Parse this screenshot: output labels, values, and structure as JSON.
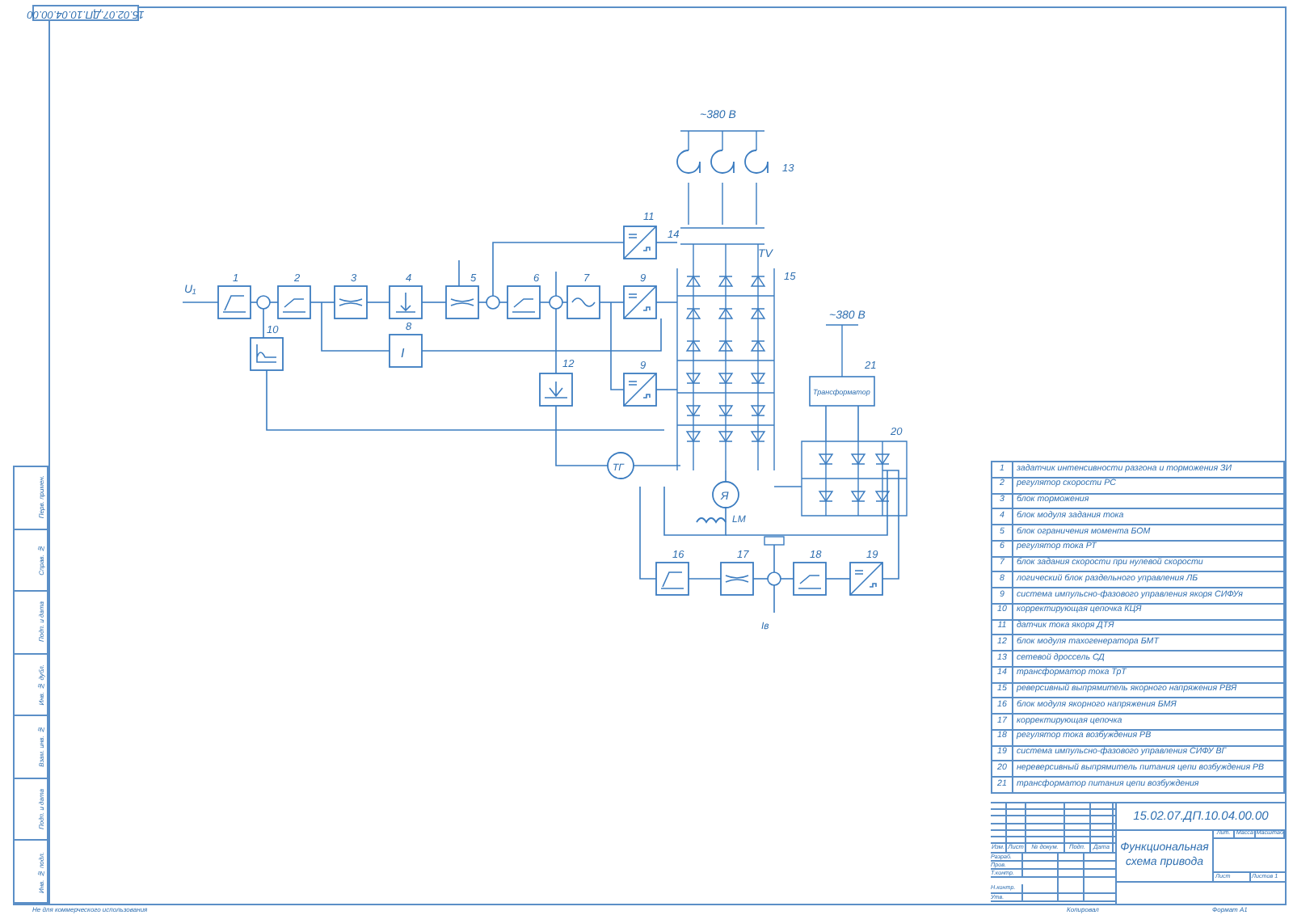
{
  "stamp": {
    "code": "15.02.07.ДП.10.04.00.00"
  },
  "side_stamp": {
    "fields": [
      "Перв. примен.",
      "Справ. №",
      "Подп. и дата",
      "Инв. № дубл.",
      "Взам. инв. №",
      "Подп. и дата",
      "Инв. № подл."
    ]
  },
  "diagram": {
    "input_label": "U₁",
    "supply_labels": [
      "~380 В",
      "~380 В"
    ],
    "transformer_label": "TV",
    "motor_label": "Я",
    "field_winding_label": "LM",
    "tacho_label": "ТГ",
    "current_label": "Iв",
    "logic_block_label": "I",
    "transformer_box_label": "Трансформатор",
    "blocks": [
      {
        "kind": "ramp"
      },
      {
        "kind": "limiter"
      },
      {
        "kind": "band"
      },
      {
        "kind": "down"
      },
      {
        "kind": "band"
      },
      {
        "kind": "limiter"
      },
      {
        "kind": "wave"
      },
      {
        "kind": "converter"
      },
      {
        "kind": "converter"
      },
      {
        "kind": "filter"
      },
      {
        "kind": "converter"
      },
      {
        "kind": "tacho"
      },
      {
        "kind": "ramp"
      },
      {
        "kind": "band"
      },
      {
        "kind": "limiter"
      },
      {
        "kind": "converter"
      }
    ],
    "markers": [
      "1",
      "2",
      "3",
      "4",
      "5",
      "6",
      "7",
      "8",
      "9",
      "9",
      "10",
      "11",
      "12",
      "13",
      "14",
      "15",
      "16",
      "17",
      "18",
      "19",
      "20",
      "21"
    ]
  },
  "legend": {
    "rows": [
      {
        "number": "1",
        "description": "задатчик интенсивности разгона и торможения ЗИ"
      },
      {
        "number": "2",
        "description": "регулятор скорости РС"
      },
      {
        "number": "3",
        "description": "блок торможения"
      },
      {
        "number": "4",
        "description": "блок модуля задания тока"
      },
      {
        "number": "5",
        "description": "блок ограничения момента БОМ"
      },
      {
        "number": "6",
        "description": "регулятор тока РТ"
      },
      {
        "number": "7",
        "description": "блок задания скорости при нулевой скорости"
      },
      {
        "number": "8",
        "description": "логический блок раздельного управления ЛБ"
      },
      {
        "number": "9",
        "description": "система импульсно-фазового управления якоря СИФУя"
      },
      {
        "number": "10",
        "description": "корректирующая цепочка КЦЯ"
      },
      {
        "number": "11",
        "description": "датчик тока якоря ДТЯ"
      },
      {
        "number": "12",
        "description": "блок модуля тахогенератора БМТ"
      },
      {
        "number": "13",
        "description": "сетевой дроссель СД"
      },
      {
        "number": "14",
        "description": "трансформатор тока ТрТ"
      },
      {
        "number": "15",
        "description": "реверсивный выпрямитель якорного напряжения РВЯ"
      },
      {
        "number": "16",
        "description": "блок модуля якорного напряжения БМЯ"
      },
      {
        "number": "17",
        "description": "корректирующая цепочка"
      },
      {
        "number": "18",
        "description": "регулятор тока возбуждения РВ"
      },
      {
        "number": "19",
        "description": "система импульсно-фазового управления СИФУ ВГ"
      },
      {
        "number": "20",
        "description": "нереверсивный выпрямитель питания цепи возбуждения РВ"
      },
      {
        "number": "21",
        "description": "трансформатор питания цепи возбуждения"
      }
    ]
  },
  "title_block": {
    "code": "15.02.07.ДП.10.04.00.00",
    "title": "Функциональная схема привода",
    "headers": [
      "Изм.",
      "Лист",
      "№ докум.",
      "Подп.",
      "Дата"
    ],
    "roles": [
      "Разраб.",
      "Пров.",
      "Т.контр.",
      "Н.контр.",
      "Утв."
    ],
    "right_headers": [
      "Лит.",
      "Масса",
      "Масштаб"
    ],
    "sheet": "Лист",
    "sheets": "Листов 1"
  },
  "footer": {
    "note": "Не для коммерческого использования",
    "copied": "Копировал",
    "format": "Формат А1"
  }
}
